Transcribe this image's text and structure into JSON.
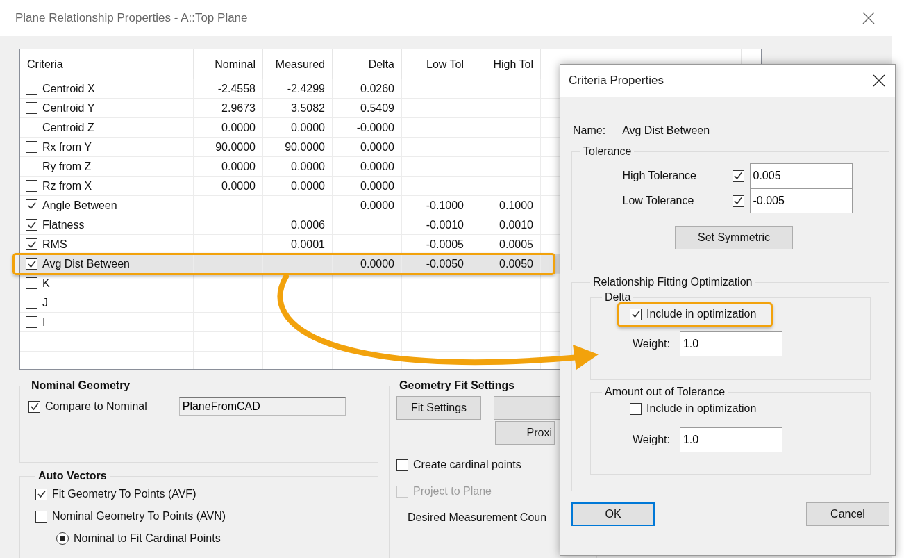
{
  "window": {
    "title": "Plane Relationship Properties - A::Top Plane"
  },
  "table": {
    "columns": [
      "Criteria",
      "Nominal",
      "Measured",
      "Delta",
      "Low Tol",
      "High Tol"
    ],
    "rows": [
      {
        "criteria": "Centroid X",
        "checked": false,
        "selected": false,
        "nominal": "-2.4558",
        "measured": "-2.4299",
        "delta": "0.0260"
      },
      {
        "criteria": "Centroid Y",
        "checked": false,
        "selected": false,
        "nominal": "2.9673",
        "measured": "3.5082",
        "delta": "0.5409"
      },
      {
        "criteria": "Centroid Z",
        "checked": false,
        "selected": false,
        "nominal": "0.0000",
        "measured": "0.0000",
        "delta": "-0.0000"
      },
      {
        "criteria": "Rx from Y",
        "checked": false,
        "selected": false,
        "nominal": "90.0000",
        "measured": "90.0000",
        "delta": "0.0000"
      },
      {
        "criteria": "Ry from Z",
        "checked": false,
        "selected": false,
        "nominal": "0.0000",
        "measured": "0.0000",
        "delta": "0.0000"
      },
      {
        "criteria": "Rz from X",
        "checked": false,
        "selected": false,
        "nominal": "0.0000",
        "measured": "0.0000",
        "delta": "0.0000"
      },
      {
        "criteria": "Angle Between",
        "checked": true,
        "selected": false,
        "delta": "0.0000",
        "low_tol": "-0.1000",
        "high_tol": "0.1000"
      },
      {
        "criteria": "Flatness",
        "checked": true,
        "selected": false,
        "measured": "0.0006",
        "low_tol": "-0.0010",
        "high_tol": "0.0010"
      },
      {
        "criteria": "RMS",
        "checked": true,
        "selected": false,
        "measured": "0.0001",
        "low_tol": "-0.0005",
        "high_tol": "0.0005"
      },
      {
        "criteria": "Avg Dist Between",
        "checked": true,
        "selected": true,
        "delta": "0.0000",
        "low_tol": "-0.0050",
        "high_tol": "0.0050"
      },
      {
        "criteria": "K",
        "checked": false,
        "selected": false
      },
      {
        "criteria": "J",
        "checked": false,
        "selected": false
      },
      {
        "criteria": "I",
        "checked": false,
        "selected": false
      }
    ]
  },
  "nominal_geometry": {
    "title": "Nominal Geometry",
    "compare": {
      "label": "Compare to Nominal",
      "checked": true
    },
    "value": "PlaneFromCAD"
  },
  "auto_vectors": {
    "title": "Auto Vectors",
    "options": [
      {
        "kind": "checkbox",
        "label": "Fit Geometry To Points (AVF)",
        "checked": true
      },
      {
        "kind": "checkbox",
        "label": "Nominal Geometry To Points (AVN)",
        "checked": false
      },
      {
        "kind": "radio",
        "label": "Nominal to Fit Cardinal Points",
        "selected": true
      }
    ]
  },
  "geometry_fit": {
    "title": "Geometry Fit Settings",
    "fit_button": "Fit Settings",
    "proximity_button": "Proxi",
    "create_cardinal": {
      "label": "Create cardinal points",
      "checked": false,
      "disabled": false
    },
    "project_to_plane": {
      "label": "Project to Plane",
      "checked": false,
      "disabled": true
    },
    "desired_count_label": "Desired Measurement Coun"
  },
  "dialog": {
    "title": "Criteria Properties",
    "name_label": "Name:",
    "name_value": "Avg Dist Between",
    "tolerance": {
      "title": "Tolerance",
      "fields": [
        {
          "label": "High Tolerance",
          "checked": true,
          "value": "0.005"
        },
        {
          "label": "Low Tolerance",
          "checked": true,
          "value": "-0.005"
        }
      ],
      "button": "Set Symmetric"
    },
    "optimization": {
      "title": "Relationship Fitting Optimization",
      "groups": [
        {
          "title": "Delta",
          "include_label": "Include in optimization",
          "checked": true,
          "highlighted": true,
          "weight_label": "Weight:",
          "weight": "1.0"
        },
        {
          "title": "Amount out of Tolerance",
          "include_label": "Include in optimization",
          "checked": false,
          "highlighted": false,
          "weight_label": "Weight:",
          "weight": "1.0"
        }
      ]
    },
    "ok": "OK",
    "cancel": "Cancel"
  }
}
